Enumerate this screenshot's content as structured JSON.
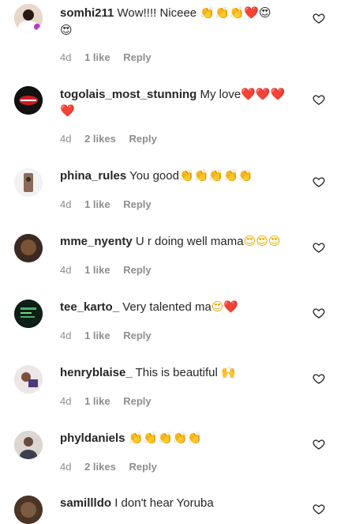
{
  "comments": [
    {
      "username": "somhi211",
      "text": "Wow!!!! Niceee",
      "emojis": "👏👏👏❤️😍",
      "emojis_line2": "😍",
      "time": "4d",
      "likes": "1 like",
      "reply": "Reply",
      "avatar_icon": "profile-photo"
    },
    {
      "username": "togolais_most_stunning",
      "text": "My love",
      "emojis": "❤️❤️❤️",
      "emojis_line2": "❤️",
      "time": "4d",
      "likes": "2 likes",
      "reply": "Reply",
      "avatar_icon": "lips-photo"
    },
    {
      "username": "phina_rules",
      "text": "You good",
      "emojis": "👏👏👏👏👏",
      "time": "4d",
      "likes": "1 like",
      "reply": "Reply",
      "avatar_icon": "profile-photo"
    },
    {
      "username": "mme_nyenty",
      "text": "U r doing well mama",
      "emojis": "😍😍😍",
      "time": "4d",
      "likes": "1 like",
      "reply": "Reply",
      "avatar_icon": "profile-photo"
    },
    {
      "username": "tee_karto_",
      "text": "Very talented ma",
      "emojis": "😍❤️",
      "time": "4d",
      "likes": "1 like",
      "reply": "Reply",
      "avatar_icon": "dark-photo"
    },
    {
      "username": "henryblaise_",
      "text": "This is beautiful",
      "emojis": "🙌",
      "time": "4d",
      "likes": "1 like",
      "reply": "Reply",
      "avatar_icon": "profile-photo"
    },
    {
      "username": "phyldaniels",
      "text": "",
      "emojis": "👏👏👏👏👏",
      "time": "4d",
      "likes": "2 likes",
      "reply": "Reply",
      "avatar_icon": "profile-photo"
    },
    {
      "username": "samillldo",
      "text": "I don't hear Yoruba",
      "emojis": "",
      "avatar_icon": "profile-photo"
    }
  ],
  "colors": {
    "text": "#262626",
    "meta": "#8e8e8e",
    "heart_outline": "#262626"
  }
}
